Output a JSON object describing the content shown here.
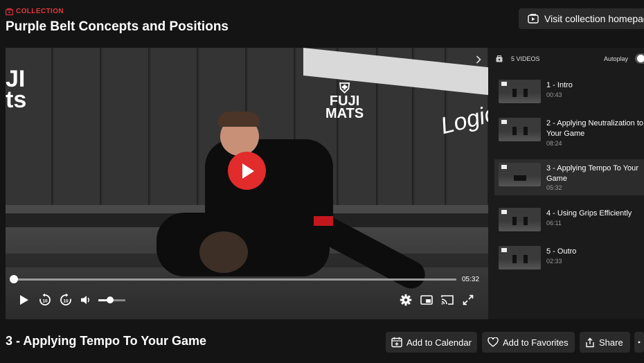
{
  "header": {
    "collection_label": "COLLECTION",
    "title": "Purple Belt Concepts and Positions",
    "visit_label": "Visit collection homepage"
  },
  "player": {
    "current_time": "05:32",
    "progress": 0.0,
    "volume": 0.45,
    "brand_left": "JI\nts",
    "brand_fuji": "FUJI\nMATS",
    "brand_logic": "Logic"
  },
  "playlist": {
    "count_label": "5 VIDEOS",
    "autoplay_label": "Autoplay",
    "autoplay_on": false,
    "items": [
      {
        "title": "1 - Intro",
        "duration": "00:43",
        "active": false
      },
      {
        "title": "2 - Applying Neutralization to Your Game",
        "duration": "08:24",
        "active": false
      },
      {
        "title": "3 - Applying Tempo To Your Game",
        "duration": "05:32",
        "active": true
      },
      {
        "title": "4 - Using Grips Efficiently",
        "duration": "06:11",
        "active": false
      },
      {
        "title": "5 - Outro",
        "duration": "02:33",
        "active": false
      }
    ]
  },
  "video": {
    "title": "3 - Applying Tempo To Your Game"
  },
  "actions": {
    "calendar_label": "Add to Calendar",
    "favorites_label": "Add to Favorites",
    "share_label": "Share"
  },
  "colors": {
    "accent": "#e22b2b",
    "background": "#141414",
    "panel": "#1b1b1b",
    "button": "#2a2a2a"
  },
  "icons": [
    "collection-icon",
    "external-link-icon",
    "play-icon",
    "rewind-10-icon",
    "forward-10-icon",
    "volume-icon",
    "gear-icon",
    "pip-icon",
    "cast-icon",
    "fullscreen-icon",
    "chevron-right-icon",
    "playlist-icon",
    "calendar-add-icon",
    "heart-icon",
    "share-icon",
    "more-icon"
  ]
}
